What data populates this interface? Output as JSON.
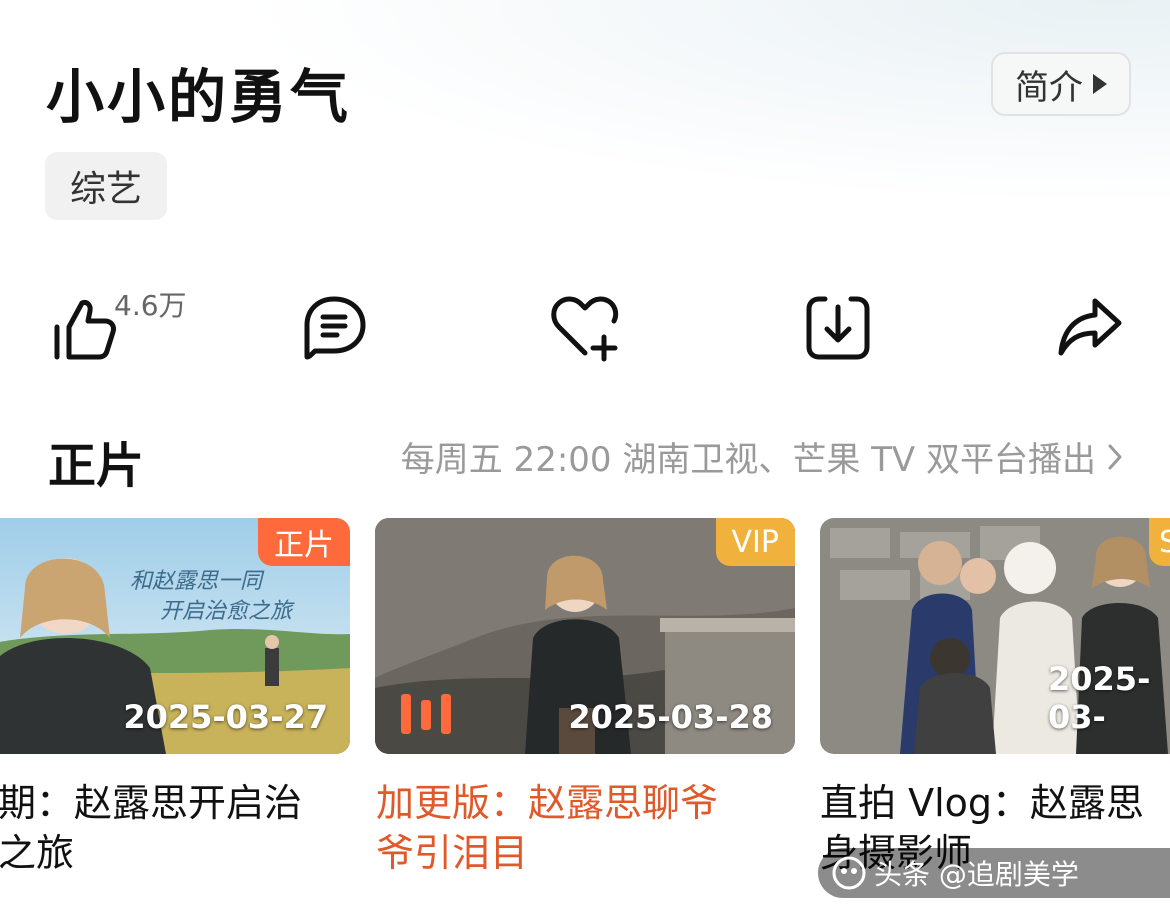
{
  "show": {
    "title": "小小的勇气",
    "intro_label": "简介",
    "tag": "综艺"
  },
  "actions": {
    "like_count": "4.6万",
    "icons": [
      "thumbs-up-icon",
      "comment-icon",
      "heart-plus-icon",
      "download-icon",
      "share-icon"
    ]
  },
  "section": {
    "title": "正片",
    "schedule": "每周五 22:00 湖南卫视、芒果 TV 双平台播出"
  },
  "episodes": [
    {
      "badge": "正片",
      "date": "2025-03-27",
      "title_line1": "期：赵露思开启治",
      "title_line2": "之旅",
      "poster_text_1": "和赵露思一同",
      "poster_text_2": "开启治愈之旅"
    },
    {
      "badge": "VIP",
      "date": "2025-03-28",
      "title_line1": "加更版：赵露思聊爷",
      "title_line2": "爷引泪目"
    },
    {
      "badge": "S",
      "date": "2025-03-",
      "title_line1": "直拍 Vlog：赵露思",
      "title_line2": "身摄影师"
    }
  ],
  "watermark": {
    "text": "头条 @追剧美学"
  },
  "colors": {
    "orange_badge": "#ff6a3d",
    "vip_badge": "#f0b23c",
    "highlight_title": "#e0592a",
    "schedule_text": "#9a9a9a"
  }
}
